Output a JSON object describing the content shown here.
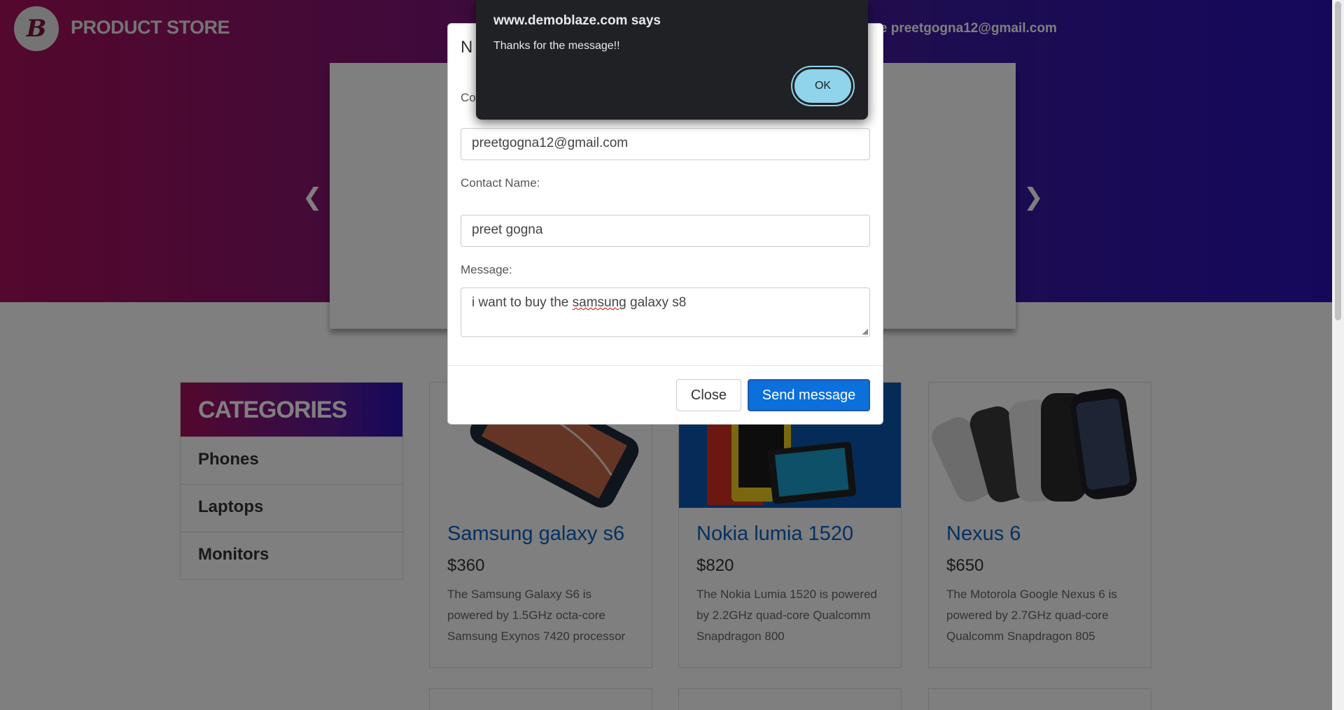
{
  "header": {
    "logo_glyph": "B",
    "brand": "PRODUCT STORE",
    "welcome_visible": "me preetgogna12@gmail.com"
  },
  "carousel": {
    "prev_icon": "chevron-left-icon",
    "next_icon": "chevron-right-icon"
  },
  "categories": {
    "heading": "CATEGORIES",
    "items": [
      "Phones",
      "Laptops",
      "Monitors"
    ]
  },
  "products": [
    {
      "title": "Samsung galaxy s6",
      "price": "$360",
      "desc": "The Samsung Galaxy S6 is powered by 1.5GHz octa-core Samsung Exynos 7420 processor"
    },
    {
      "title": "Nokia lumia 1520",
      "price": "$820",
      "desc": "The Nokia Lumia 1520 is powered by 2.2GHz quad-core Qualcomm Snapdragon 800"
    },
    {
      "title": "Nexus 6",
      "price": "$650",
      "desc": "The Motorola Google Nexus 6 is powered by 2.7GHz quad-core Qualcomm Snapdragon 805"
    }
  ],
  "modal": {
    "title_visible": "N",
    "email_label_visible": "Co",
    "email_value": "preetgogna12@gmail.com",
    "name_label": "Contact Name:",
    "name_value": "preet gogna",
    "message_label": "Message:",
    "message_before": "i want to buy the ",
    "message_misspelled": "samsung",
    "message_after": " galaxy s8",
    "close_label": "Close",
    "send_label": "Send message"
  },
  "alert": {
    "title": "www.demoblaze.com says",
    "message": "Thanks for the message!!",
    "ok_label": "OK"
  },
  "colors": {
    "accent_link": "#0a62c2",
    "send_button": "#0b6fdc",
    "alert_ok": "#8fd4ea",
    "alert_bg": "#202124"
  }
}
